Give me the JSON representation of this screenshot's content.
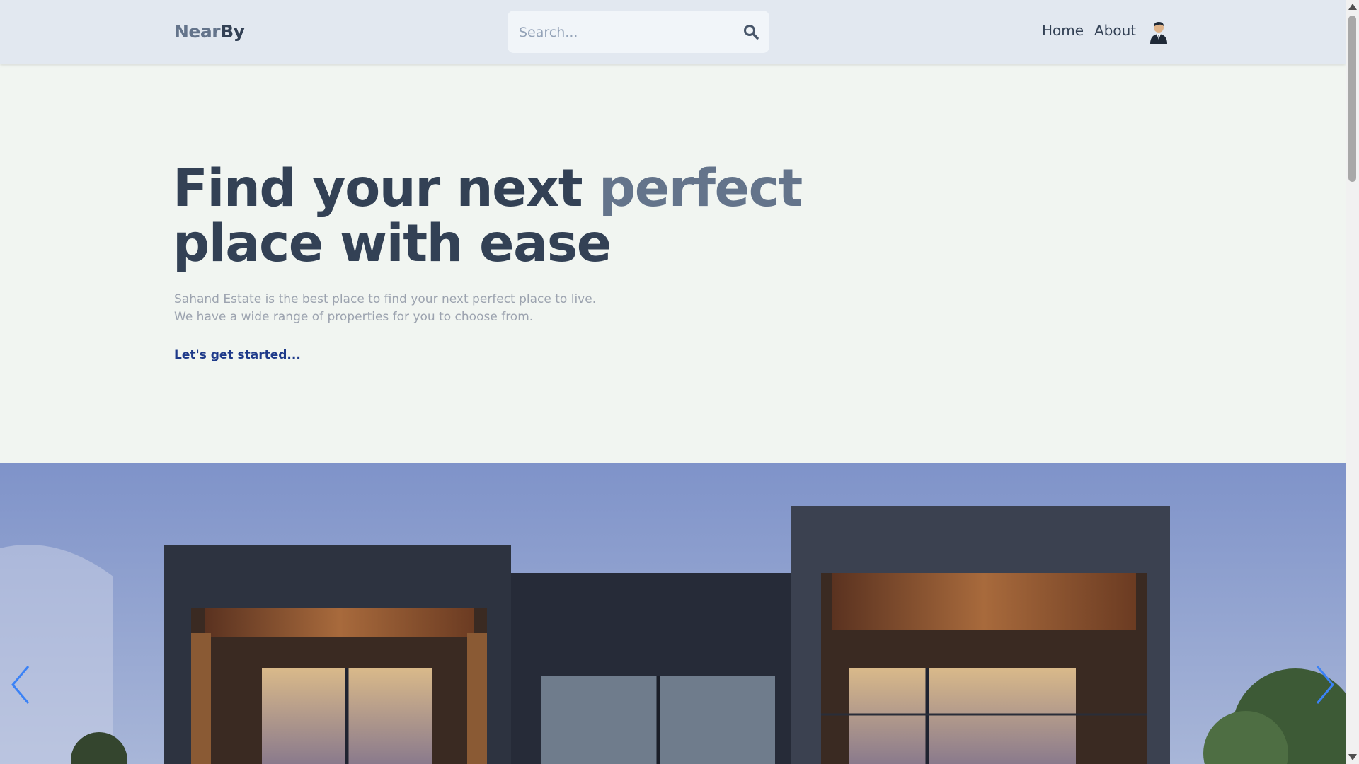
{
  "header": {
    "logo_part1": "Near",
    "logo_part2": "By",
    "search_placeholder": "Search...",
    "nav": {
      "home": "Home",
      "about": "About"
    }
  },
  "hero": {
    "title_part1": "Find your next ",
    "title_accent": "perfect",
    "title_part2": "place with ease",
    "description_line1": "Sahand Estate is the best place to find your next perfect place to live.",
    "description_line2": "We have a wide range of properties for you to choose from.",
    "cta": "Let's get started..."
  },
  "colors": {
    "header_bg": "#e2e8f0",
    "page_bg": "#f1f5f1",
    "title": "#334155",
    "accent": "#64748b",
    "cta": "#1e3a8a",
    "carousel_arrow": "#3b82f6"
  },
  "icons": {
    "search": "search-icon",
    "avatar": "user-avatar",
    "prev": "chevron-left-icon",
    "next": "chevron-right-icon"
  }
}
